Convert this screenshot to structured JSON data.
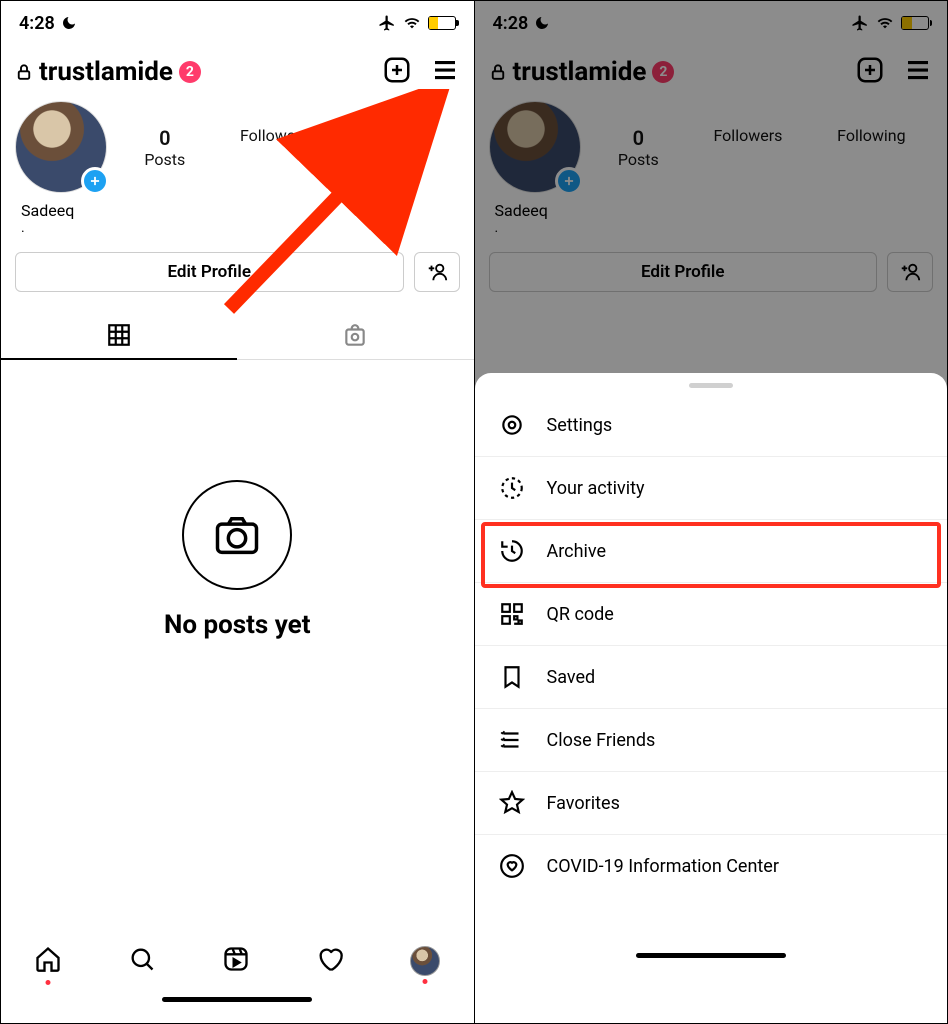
{
  "status": {
    "time": "4:28",
    "icons": {
      "moon": true,
      "airplane": true,
      "wifi": true,
      "battery_pct": 38
    }
  },
  "header": {
    "username": "trustlamide",
    "notification_count": "2"
  },
  "profile": {
    "display_name": "Sadeeq",
    "bio_line": ".",
    "edit_label": "Edit Profile"
  },
  "stats": {
    "posts": {
      "count": "0",
      "label": "Posts"
    },
    "followers": {
      "count": "",
      "label": "Followers"
    },
    "following": {
      "count": "",
      "label": "Following"
    }
  },
  "empty": {
    "title": "No posts yet"
  },
  "menu": {
    "items": [
      {
        "icon": "settings",
        "label": "Settings"
      },
      {
        "icon": "activity",
        "label": "Your activity"
      },
      {
        "icon": "archive",
        "label": "Archive"
      },
      {
        "icon": "qrcode",
        "label": "QR code"
      },
      {
        "icon": "saved",
        "label": "Saved"
      },
      {
        "icon": "closefriends",
        "label": "Close Friends"
      },
      {
        "icon": "favorites",
        "label": "Favorites"
      },
      {
        "icon": "covid",
        "label": "COVID-19 Information Center"
      }
    ]
  }
}
